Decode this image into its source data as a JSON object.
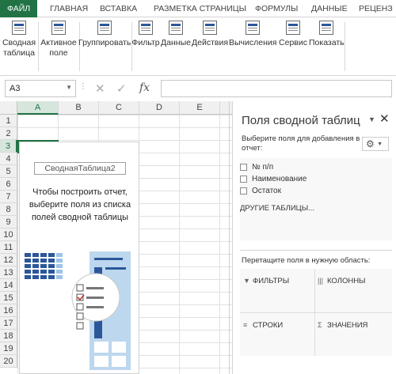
{
  "ribbon_tabs": [
    "ФАЙЛ",
    "ГЛАВНАЯ",
    "ВСТАВКА",
    "РАЗМЕТКА СТРАНИЦЫ",
    "ФОРМУЛЫ",
    "ДАННЫЕ",
    "РЕЦЕНЗ"
  ],
  "active_tab_color": "#217346",
  "ribbon_buttons": [
    {
      "label1": "Сводная",
      "label2": "таблица",
      "icon": "pivot-table-icon"
    },
    {
      "label1": "Активное",
      "label2": "поле",
      "icon": "active-field-icon"
    },
    {
      "label1": "Группировать",
      "label2": "",
      "icon": "group-icon"
    },
    {
      "label1": "Фильтр",
      "label2": "",
      "icon": "filter-icon"
    },
    {
      "label1": "Данные",
      "label2": "",
      "icon": "data-icon"
    },
    {
      "label1": "Действия",
      "label2": "",
      "icon": "actions-icon"
    },
    {
      "label1": "Вычисления",
      "label2": "",
      "icon": "calculations-icon"
    },
    {
      "label1": "Сервис",
      "label2": "",
      "icon": "tools-icon"
    },
    {
      "label1": "Показать",
      "label2": "",
      "icon": "show-icon"
    }
  ],
  "formula_bar": {
    "name_box": "A3",
    "fx": "fx",
    "cancel": "✕",
    "enter": "✓",
    "formula": ""
  },
  "sheet": {
    "columns": [
      "A",
      "B",
      "C",
      "D",
      "E"
    ],
    "rows": [
      "1",
      "2",
      "3",
      "4",
      "5",
      "6",
      "7",
      "8",
      "9",
      "10",
      "11",
      "12",
      "13",
      "14",
      "15",
      "16",
      "17",
      "18",
      "19",
      "20"
    ],
    "selected_column": "A",
    "selected_row": "3"
  },
  "pivot_placeholder": {
    "name": "СводнаяТаблица2",
    "instruction": "Чтобы построить отчет, выберите поля из списка полей сводной таблицы"
  },
  "pivot_pane": {
    "title": "Поля сводной таблиц",
    "subtitle": "Выберите поля для добавления в отчет:",
    "fields": [
      "№ п/п",
      "Наименование",
      "Остаток"
    ],
    "other_tables": "ДРУГИЕ ТАБЛИЦЫ...",
    "drag_hint": "Перетащите поля в нужную область:",
    "areas": {
      "filters": "ФИЛЬТРЫ",
      "columns": "КОЛОННЫ",
      "rows": "СТРОКИ",
      "values": "ЗНАЧЕНИЯ"
    }
  }
}
